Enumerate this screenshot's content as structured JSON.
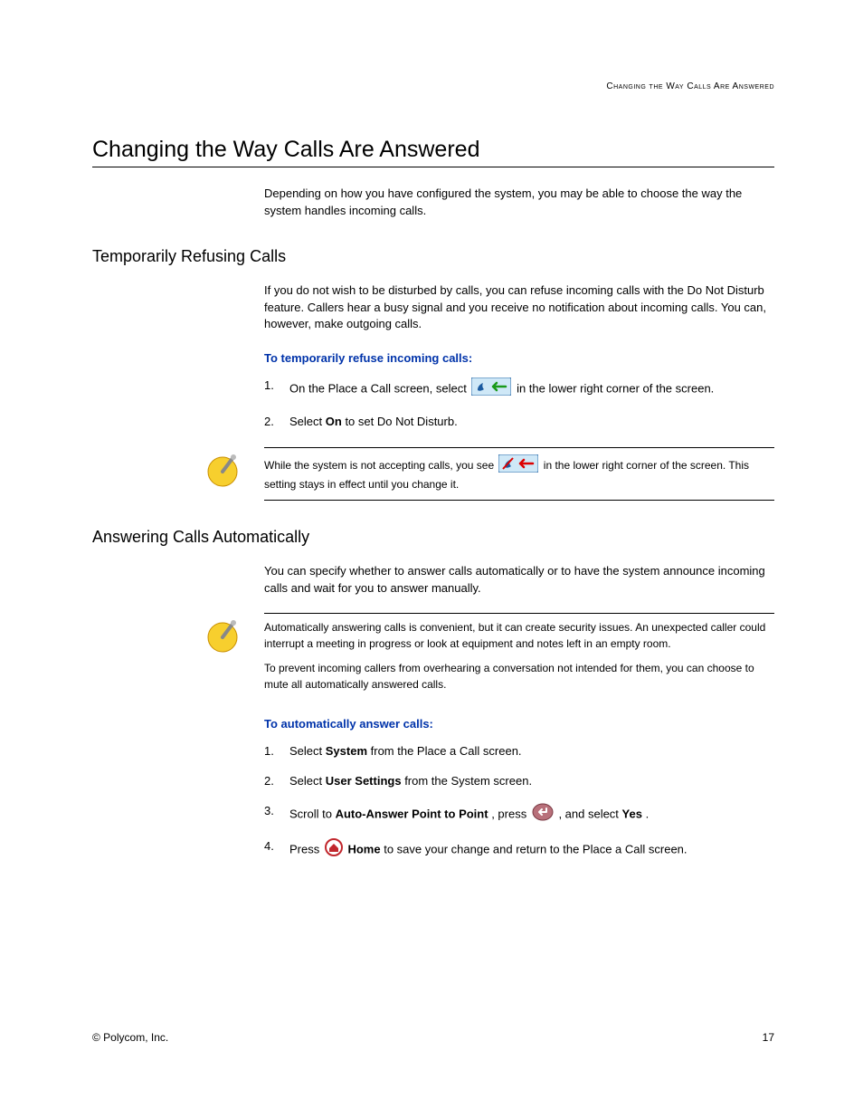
{
  "running_header": "Changing the Way Calls Are Answered",
  "h1": "Changing the Way Calls Are Answered",
  "intro": "Depending on how you have configured the system, you may be able to choose the way the system handles incoming calls.",
  "section1": {
    "title": "Temporarily Refusing Calls",
    "intro": "If you do not wish to be disturbed by calls, you can refuse incoming calls with the Do Not Disturb feature. Callers hear a busy signal and you receive no notification about incoming calls. You can, however, make outgoing calls.",
    "procedure_title": "To temporarily refuse incoming calls:",
    "step1_a": "On the Place a Call screen, select ",
    "step1_b": " in the lower right corner of the screen.",
    "step2_a": "Select ",
    "step2_bold": "On",
    "step2_b": " to set Do Not Disturb.",
    "note_a": "While the system is not accepting calls, you see ",
    "note_b": " in the lower right corner of the screen. This setting stays in effect until you change it."
  },
  "section2": {
    "title": "Answering Calls Automatically",
    "intro": "You can specify whether to answer calls automatically or to have the system announce incoming calls and wait for you to answer manually.",
    "note_p1": "Automatically answering calls is convenient, but it can create security issues. An unexpected caller could interrupt a meeting in progress or look at equipment and notes left in an empty room.",
    "note_p2": "To prevent incoming callers from overhearing a conversation not intended for them, you can choose to mute all automatically answered calls.",
    "procedure_title": "To automatically answer calls:",
    "step1_a": "Select ",
    "step1_bold": "System",
    "step1_b": " from the Place a Call screen.",
    "step2_a": "Select ",
    "step2_bold": "User Settings",
    "step2_b": " from the System screen.",
    "step3_a": "Scroll to ",
    "step3_bold1": "Auto-Answer Point to Point",
    "step3_b": ", press ",
    "step3_c": ", and select ",
    "step3_bold2": "Yes",
    "step3_d": ".",
    "step4_a": "Press ",
    "step4_bold": "Home",
    "step4_b": " to save your change and return to the Place a Call screen."
  },
  "footer_left": "© Polycom, Inc.",
  "footer_right": "17"
}
